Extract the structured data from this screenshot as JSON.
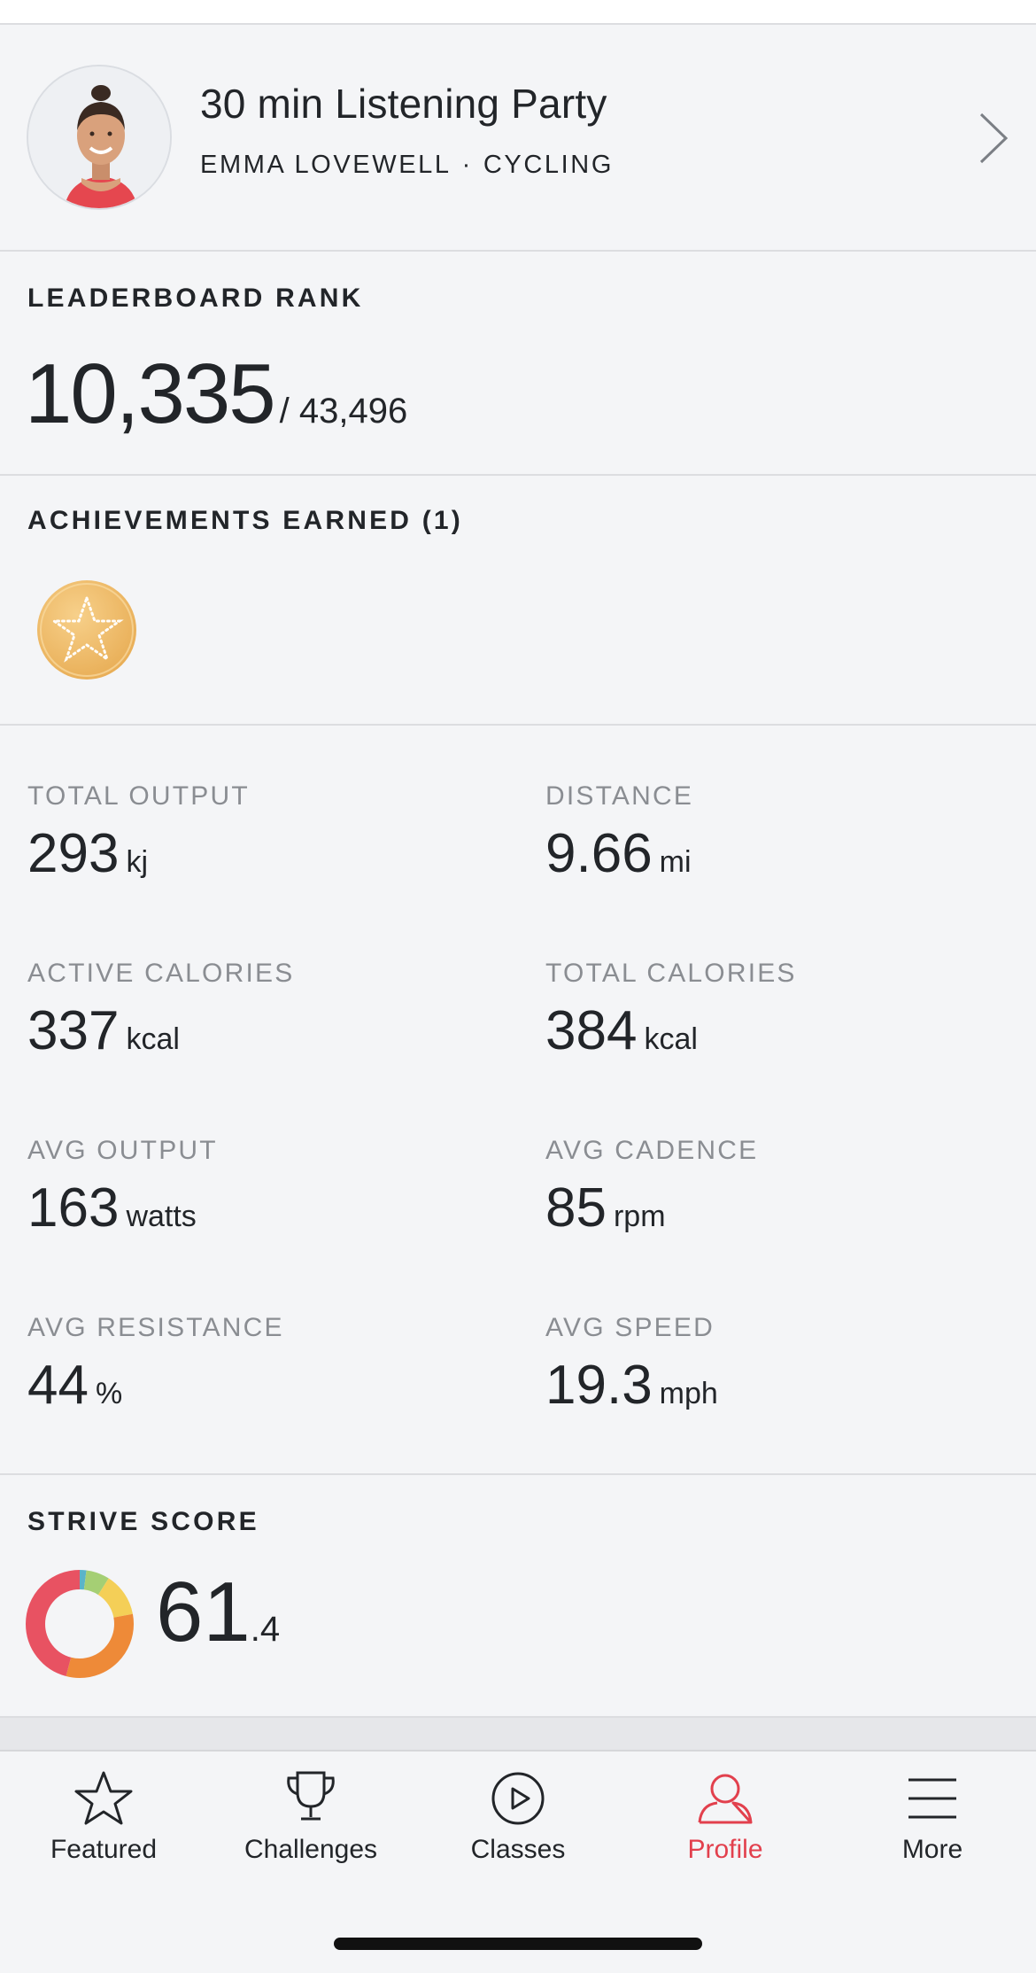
{
  "class_card": {
    "title": "30 min Listening Party",
    "instructor": "EMMA LOVEWELL",
    "separator": "·",
    "discipline": "CYCLING"
  },
  "leaderboard": {
    "label": "LEADERBOARD RANK",
    "rank": "10,335",
    "total": "/ 43,496"
  },
  "achievements": {
    "label": "ACHIEVEMENTS EARNED (1)",
    "badges": [
      {
        "icon": "star-medal-icon",
        "color": "#f0c06a"
      }
    ]
  },
  "stats": [
    {
      "label": "TOTAL OUTPUT",
      "value": "293",
      "unit": "kj"
    },
    {
      "label": "DISTANCE",
      "value": "9.66",
      "unit": "mi"
    },
    {
      "label": "ACTIVE CALORIES",
      "value": "337",
      "unit": "kcal"
    },
    {
      "label": "TOTAL CALORIES",
      "value": "384",
      "unit": "kcal"
    },
    {
      "label": "AVG OUTPUT",
      "value": "163",
      "unit": "watts"
    },
    {
      "label": "AVG CADENCE",
      "value": "85",
      "unit": "rpm"
    },
    {
      "label": "AVG RESISTANCE",
      "value": "44",
      "unit": "%"
    },
    {
      "label": "AVG SPEED",
      "value": "19.3",
      "unit": "mph"
    }
  ],
  "strive": {
    "label": "STRIVE SCORE",
    "score_main": "61",
    "score_decimal": ".4",
    "zones": [
      {
        "color": "#5bb4c9",
        "fraction": 0.02
      },
      {
        "color": "#a5cf74",
        "fraction": 0.07
      },
      {
        "color": "#f4cf57",
        "fraction": 0.13
      },
      {
        "color": "#ee8a38",
        "fraction": 0.32
      },
      {
        "color": "#e85262",
        "fraction": 0.46
      }
    ]
  },
  "tabs": [
    {
      "label": "Featured",
      "icon": "star-icon",
      "active": false
    },
    {
      "label": "Challenges",
      "icon": "trophy-icon",
      "active": false
    },
    {
      "label": "Classes",
      "icon": "play-circle-icon",
      "active": false
    },
    {
      "label": "Profile",
      "icon": "person-icon",
      "active": true
    },
    {
      "label": "More",
      "icon": "menu-icon",
      "active": false
    }
  ],
  "colors": {
    "accent": "#e2404d",
    "background": "#f4f5f7",
    "muted_text": "#8a8d92",
    "text": "#222529"
  }
}
